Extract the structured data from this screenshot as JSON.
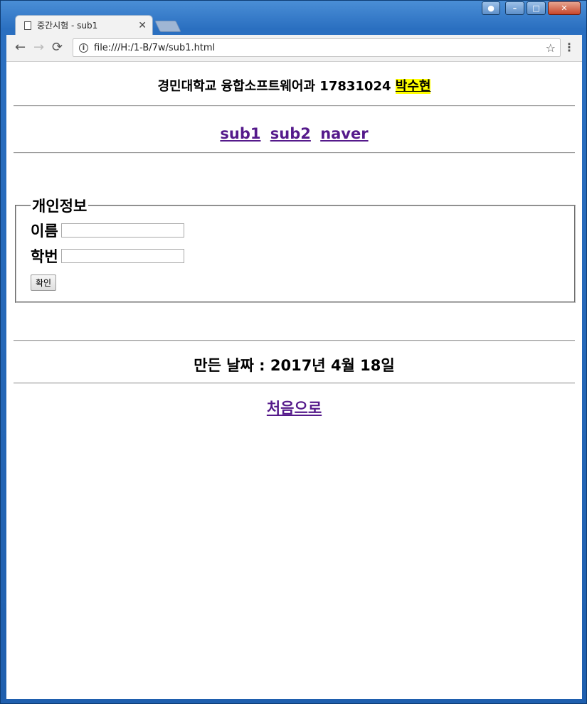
{
  "window": {
    "tab_title": "중간시험 - sub1",
    "caption_min": "–",
    "caption_max": "□",
    "caption_close": "✕",
    "icons": [
      "user-icon",
      "minimize-icon",
      "maximize-icon",
      "close-icon",
      "document-icon",
      "tab-close-icon",
      "new-tab-icon"
    ]
  },
  "toolbar": {
    "url": "file:///H:/1-B/7w/sub1.html",
    "back": "←",
    "forward": "→",
    "reload": "⟳",
    "info": "i",
    "star": "☆",
    "menu": "⋮",
    "tab_close": "✕"
  },
  "page": {
    "header_text": "경민대학교 융합소프트웨어과 17831024",
    "header_name": "박수현",
    "highlight_color": "#ffff00",
    "link_color": "#551a8b",
    "nav_links": [
      "sub1",
      "sub2",
      "naver"
    ],
    "form": {
      "legend": "개인정보",
      "name_label": "이름",
      "name_value": "",
      "id_label": "학번",
      "id_value": "",
      "submit_label": "확인"
    },
    "created_date": "만든 날짜 : 2017년 4월 18일",
    "home_link": "처음으로"
  }
}
